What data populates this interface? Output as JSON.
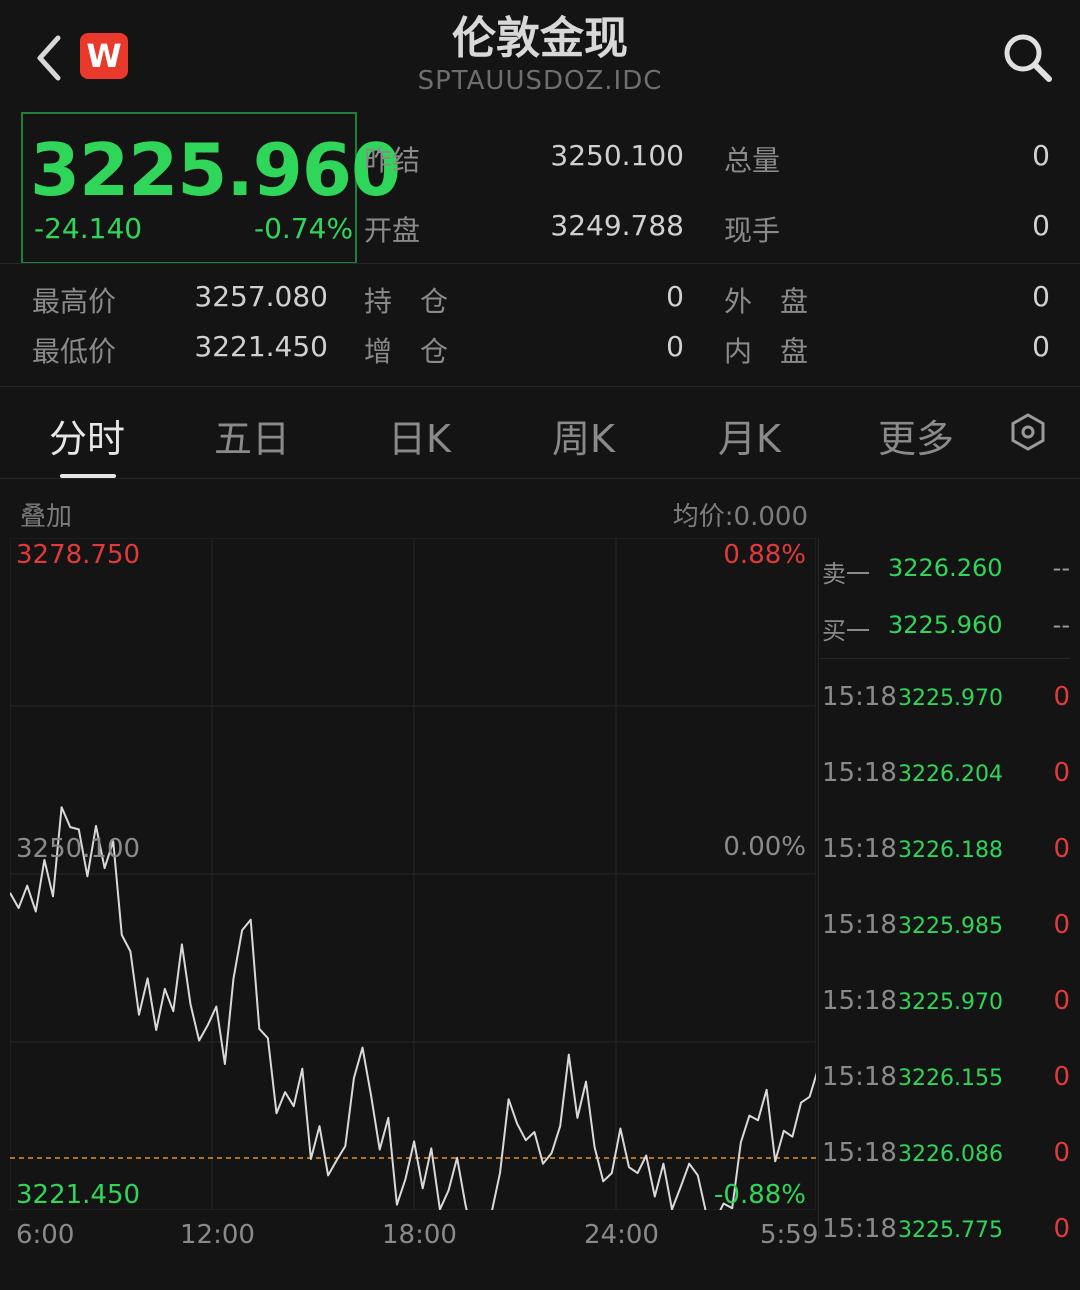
{
  "header": {
    "title": "伦敦金现",
    "code": "SPTAUUSDOZ.IDC",
    "logo_text": "W"
  },
  "quote": {
    "price": "3225.960",
    "change": "-24.140",
    "change_pct": "-0.74%",
    "prev_settle_label": "昨结",
    "prev_settle": "3250.100",
    "open_label": "开盘",
    "open": "3249.788",
    "total_vol_label": "总量",
    "total_vol": "0",
    "current_hand_label": "现手",
    "current_hand": "0",
    "high_label": "最高价",
    "high": "3257.080",
    "low_label": "最低价",
    "low": "3221.450",
    "oi_label": "持　仓",
    "oi": "0",
    "oi_inc_label": "增　仓",
    "oi_inc": "0",
    "outer_label": "外　盘",
    "outer": "0",
    "inner_label": "内　盘",
    "inner": "0"
  },
  "tabs": [
    {
      "label": "分时",
      "active": true
    },
    {
      "label": "五日",
      "active": false
    },
    {
      "label": "日K",
      "active": false
    },
    {
      "label": "周K",
      "active": false
    },
    {
      "label": "月K",
      "active": false
    },
    {
      "label": "更多",
      "active": false
    }
  ],
  "chart": {
    "overlay_label": "叠加",
    "avg_label": "均价:0.000",
    "top_price": "3278.750",
    "top_pct": "0.88%",
    "mid_price": "3250.100",
    "mid_pct": "0.00%",
    "bottom_price": "3221.450",
    "bottom_pct": "-0.88%",
    "times": [
      "6:00",
      "12:00",
      "18:00",
      "24:00",
      "5:59"
    ],
    "line_color": "#d9d9d9",
    "ref_line_color": "#e8902a"
  },
  "chart_data": {
    "type": "line",
    "x": [
      0,
      0.5,
      1.0,
      1.5,
      2.0,
      2.5,
      3.0,
      3.5,
      4.0,
      4.5,
      5.0,
      5.5,
      6.0,
      6.5,
      7.0,
      7.5,
      8.0,
      8.5,
      9.0,
      9.5,
      10.0,
      10.5,
      11.0,
      11.5,
      12.0,
      12.5,
      13.0,
      13.5,
      14.0,
      14.5,
      15.0,
      15.5,
      16.0,
      16.5,
      17.0,
      17.5,
      18.0,
      18.5,
      19.0,
      19.5,
      20.0,
      20.5,
      21.0,
      21.5,
      22.0,
      22.5,
      23.0,
      23.5,
      24.0,
      24.5,
      25.0,
      25.5,
      26.0,
      26.5,
      27.0,
      27.5,
      28.0,
      28.5,
      29.0,
      29.5,
      30.0,
      30.5,
      31.0,
      31.5,
      32.0,
      32.5,
      33.0,
      33.5,
      34.0,
      34.5,
      35.0,
      35.5,
      36.0,
      36.5,
      37.0,
      37.5,
      38.0,
      38.5,
      39.0,
      39.5,
      40.0,
      40.5,
      41.0,
      41.5,
      42.0,
      42.5,
      43.0,
      43.5,
      44.0,
      44.5,
      45.0,
      45.5,
      46.0,
      46.5,
      47.0,
      47.5,
      48.0,
      48.5,
      49.0,
      49.5
    ],
    "values": [
      3248.5,
      3247.2,
      3249.1,
      3246.9,
      3251.3,
      3248.2,
      3255.8,
      3254.1,
      3253.9,
      3249.9,
      3254.2,
      3250.6,
      3252.9,
      3244.9,
      3243.5,
      3238.1,
      3241.2,
      3236.8,
      3240.3,
      3238.4,
      3244.1,
      3239.0,
      3235.9,
      3237.2,
      3238.8,
      3233.9,
      3241.2,
      3245.3,
      3246.2,
      3236.9,
      3236.1,
      3229.7,
      3231.5,
      3230.3,
      3233.5,
      3225.8,
      3228.6,
      3224.4,
      3225.7,
      3226.9,
      3232.7,
      3235.3,
      3231.2,
      3226.6,
      3229.3,
      3221.9,
      3224.1,
      3227.3,
      3223.3,
      3226.7,
      3221.5,
      3223.1,
      3225.9,
      3221.8,
      3218.8,
      3219.9,
      3221.2,
      3224.6,
      3230.9,
      3228.8,
      3227.4,
      3228.1,
      3225.4,
      3226.3,
      3228.6,
      3234.7,
      3229.3,
      3232.4,
      3226.8,
      3223.9,
      3224.6,
      3228.4,
      3225.1,
      3224.6,
      3226.1,
      3222.6,
      3225.4,
      3221.5,
      3223.4,
      3225.4,
      3224.4,
      3221.1,
      3220.5,
      3222.0,
      3221.6,
      3227.2,
      3229.5,
      3229.1,
      3231.7,
      3225.6,
      3228.2,
      3227.7,
      3230.6,
      3231.1,
      3233.5,
      3234.8,
      3231.6,
      3227.3,
      3224.5,
      3222.6
    ],
    "ylim": [
      3221.45,
      3278.75
    ],
    "reference_price": 3250.1,
    "x_ticks": [
      "6:00",
      "12:00",
      "18:00",
      "24:00",
      "5:59"
    ]
  },
  "orderbook": {
    "ask_label": "卖一",
    "ask_price": "3226.260",
    "ask_vol": "--",
    "bid_label": "买一",
    "bid_price": "3225.960",
    "bid_vol": "--"
  },
  "ticks": [
    {
      "time": "15:18",
      "price": "3225.970",
      "vol": "0"
    },
    {
      "time": "15:18",
      "price": "3226.204",
      "vol": "0"
    },
    {
      "time": "15:18",
      "price": "3226.188",
      "vol": "0"
    },
    {
      "time": "15:18",
      "price": "3225.985",
      "vol": "0"
    },
    {
      "time": "15:18",
      "price": "3225.970",
      "vol": "0"
    },
    {
      "time": "15:18",
      "price": "3226.155",
      "vol": "0"
    },
    {
      "time": "15:18",
      "price": "3226.086",
      "vol": "0"
    },
    {
      "time": "15:18",
      "price": "3225.775",
      "vol": "0"
    }
  ]
}
